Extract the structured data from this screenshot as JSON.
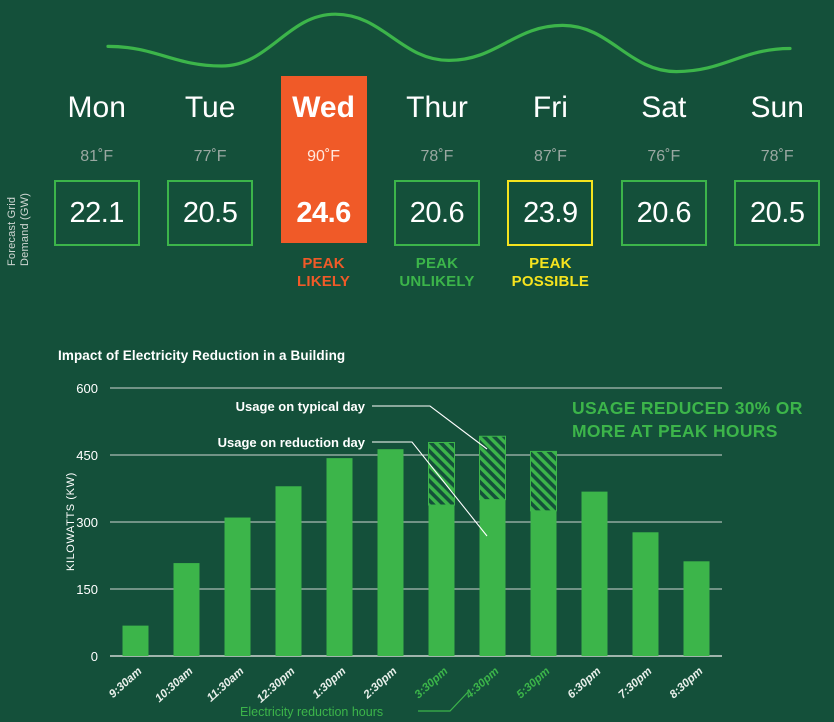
{
  "colors": {
    "background": "#14503a",
    "green": "#3cb54a",
    "orange": "#f05a28",
    "yellow": "#f5e31e",
    "white": "#ffffff",
    "muted": "#9aa8a2",
    "gridline": "#cfd6d2"
  },
  "forecast": {
    "axis_label": "Forecast Grid\nDemand (GW)",
    "sparkline": {
      "points": [
        0.52,
        0.8,
        0.06,
        0.72,
        0.22,
        0.88,
        0.55
      ]
    },
    "days": [
      {
        "name": "Mon",
        "temp": "81˚F",
        "demand": "22.1",
        "status": "",
        "level": "normal"
      },
      {
        "name": "Tue",
        "temp": "77˚F",
        "demand": "20.5",
        "status": "",
        "level": "normal"
      },
      {
        "name": "Wed",
        "temp": "90˚F",
        "demand": "24.6",
        "status": "PEAK\nLIKELY",
        "level": "likely"
      },
      {
        "name": "Thur",
        "temp": "78˚F",
        "demand": "20.6",
        "status": "PEAK\nUNLIKELY",
        "level": "unlikely"
      },
      {
        "name": "Fri",
        "temp": "87˚F",
        "demand": "23.9",
        "status": "PEAK\nPOSSIBLE",
        "level": "possible"
      },
      {
        "name": "Sat",
        "temp": "76˚F",
        "demand": "20.6",
        "status": "",
        "level": "normal"
      },
      {
        "name": "Sun",
        "temp": "78˚F",
        "demand": "20.5",
        "status": "",
        "level": "normal"
      }
    ]
  },
  "chart_data": {
    "type": "bar",
    "title": "Impact of Electricity Reduction in a Building",
    "xlabel": "",
    "ylabel": "KILOWATTS (KW)",
    "ylim": [
      0,
      600
    ],
    "yticks": [
      0,
      150,
      300,
      450,
      600
    ],
    "ytick_labels": [
      "0",
      "150",
      "300",
      "450",
      "600"
    ],
    "grid": true,
    "legend_position": "annotation-callouts",
    "categories": [
      "9:30am",
      "10:30am",
      "11:30am",
      "12:30pm",
      "1:30pm",
      "2:30pm",
      "3:30pm",
      "4:30pm",
      "5:30pm",
      "6:30pm",
      "7:30pm",
      "8:30pm"
    ],
    "reduction_hours": [
      "3:30pm",
      "4:30pm",
      "5:30pm"
    ],
    "series": [
      {
        "name": "Usage on reduction day",
        "style": "solid",
        "values": [
          68,
          208,
          310,
          380,
          443,
          463,
          338,
          350,
          325,
          368,
          277,
          212
        ]
      },
      {
        "name": "Usage on typical day",
        "style": "hatched",
        "values": [
          68,
          208,
          310,
          380,
          443,
          463,
          478,
          492,
          458,
          368,
          277,
          212
        ]
      }
    ],
    "annotations": [
      {
        "name": "typical-day-callout",
        "text": "Usage on typical day"
      },
      {
        "name": "reduction-day-callout",
        "text": "Usage on reduction day"
      },
      {
        "name": "reduction-hours-label",
        "text": "Electricity reduction hours"
      }
    ],
    "callout": {
      "line1": "USAGE REDUCED 30% OR",
      "line2": "MORE AT PEAK HOURS"
    }
  }
}
